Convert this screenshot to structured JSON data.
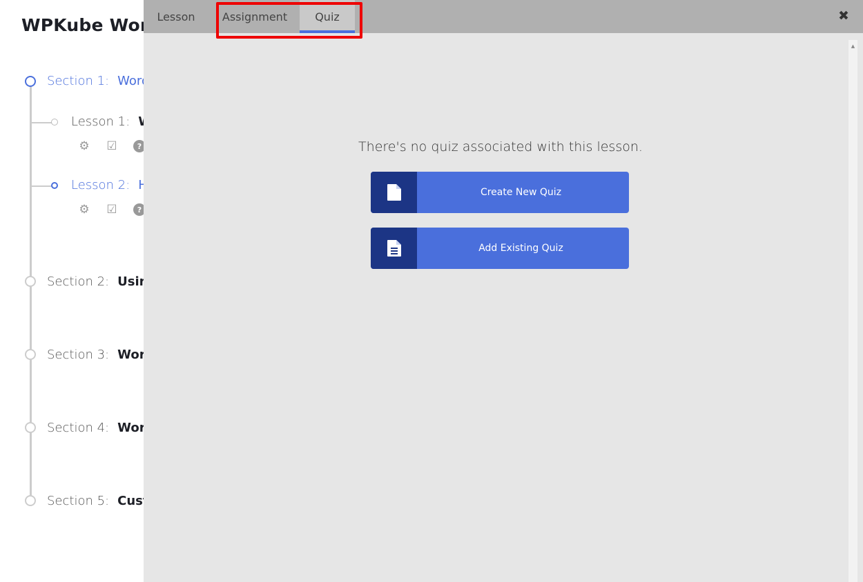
{
  "course": {
    "title": "WPKube Word",
    "sections": [
      {
        "prefix": "Section 1:",
        "name": "Word",
        "active": true
      },
      {
        "prefix": "Section 2:",
        "name": "Using",
        "active": false
      },
      {
        "prefix": "Section 3:",
        "name": "Word",
        "active": false
      },
      {
        "prefix": "Section 4:",
        "name": "Word",
        "active": false
      },
      {
        "prefix": "Section 5:",
        "name": "Custo",
        "active": false
      }
    ],
    "lessons": [
      {
        "prefix": "Lesson 1:",
        "name": "W",
        "active": false
      },
      {
        "prefix": "Lesson 2:",
        "name": "H",
        "active": true
      }
    ],
    "lesson_icons": [
      "gear-icon",
      "check-square-icon",
      "question-circle-icon"
    ]
  },
  "modal": {
    "tabs": [
      {
        "label": "Lesson",
        "active": false
      },
      {
        "label": "Assignment",
        "active": false
      },
      {
        "label": "Quiz",
        "active": true
      }
    ],
    "close_icon": "✖",
    "empty_message": "There's no quiz associated with this lesson.",
    "buttons": {
      "create": {
        "label": "Create New Quiz",
        "icon": "file-icon"
      },
      "existing": {
        "label": "Add Existing Quiz",
        "icon": "file-text-icon"
      }
    },
    "colors": {
      "accent": "#4a6fdc",
      "accent_dark": "#1c3585",
      "highlight": "#ee0000"
    }
  }
}
